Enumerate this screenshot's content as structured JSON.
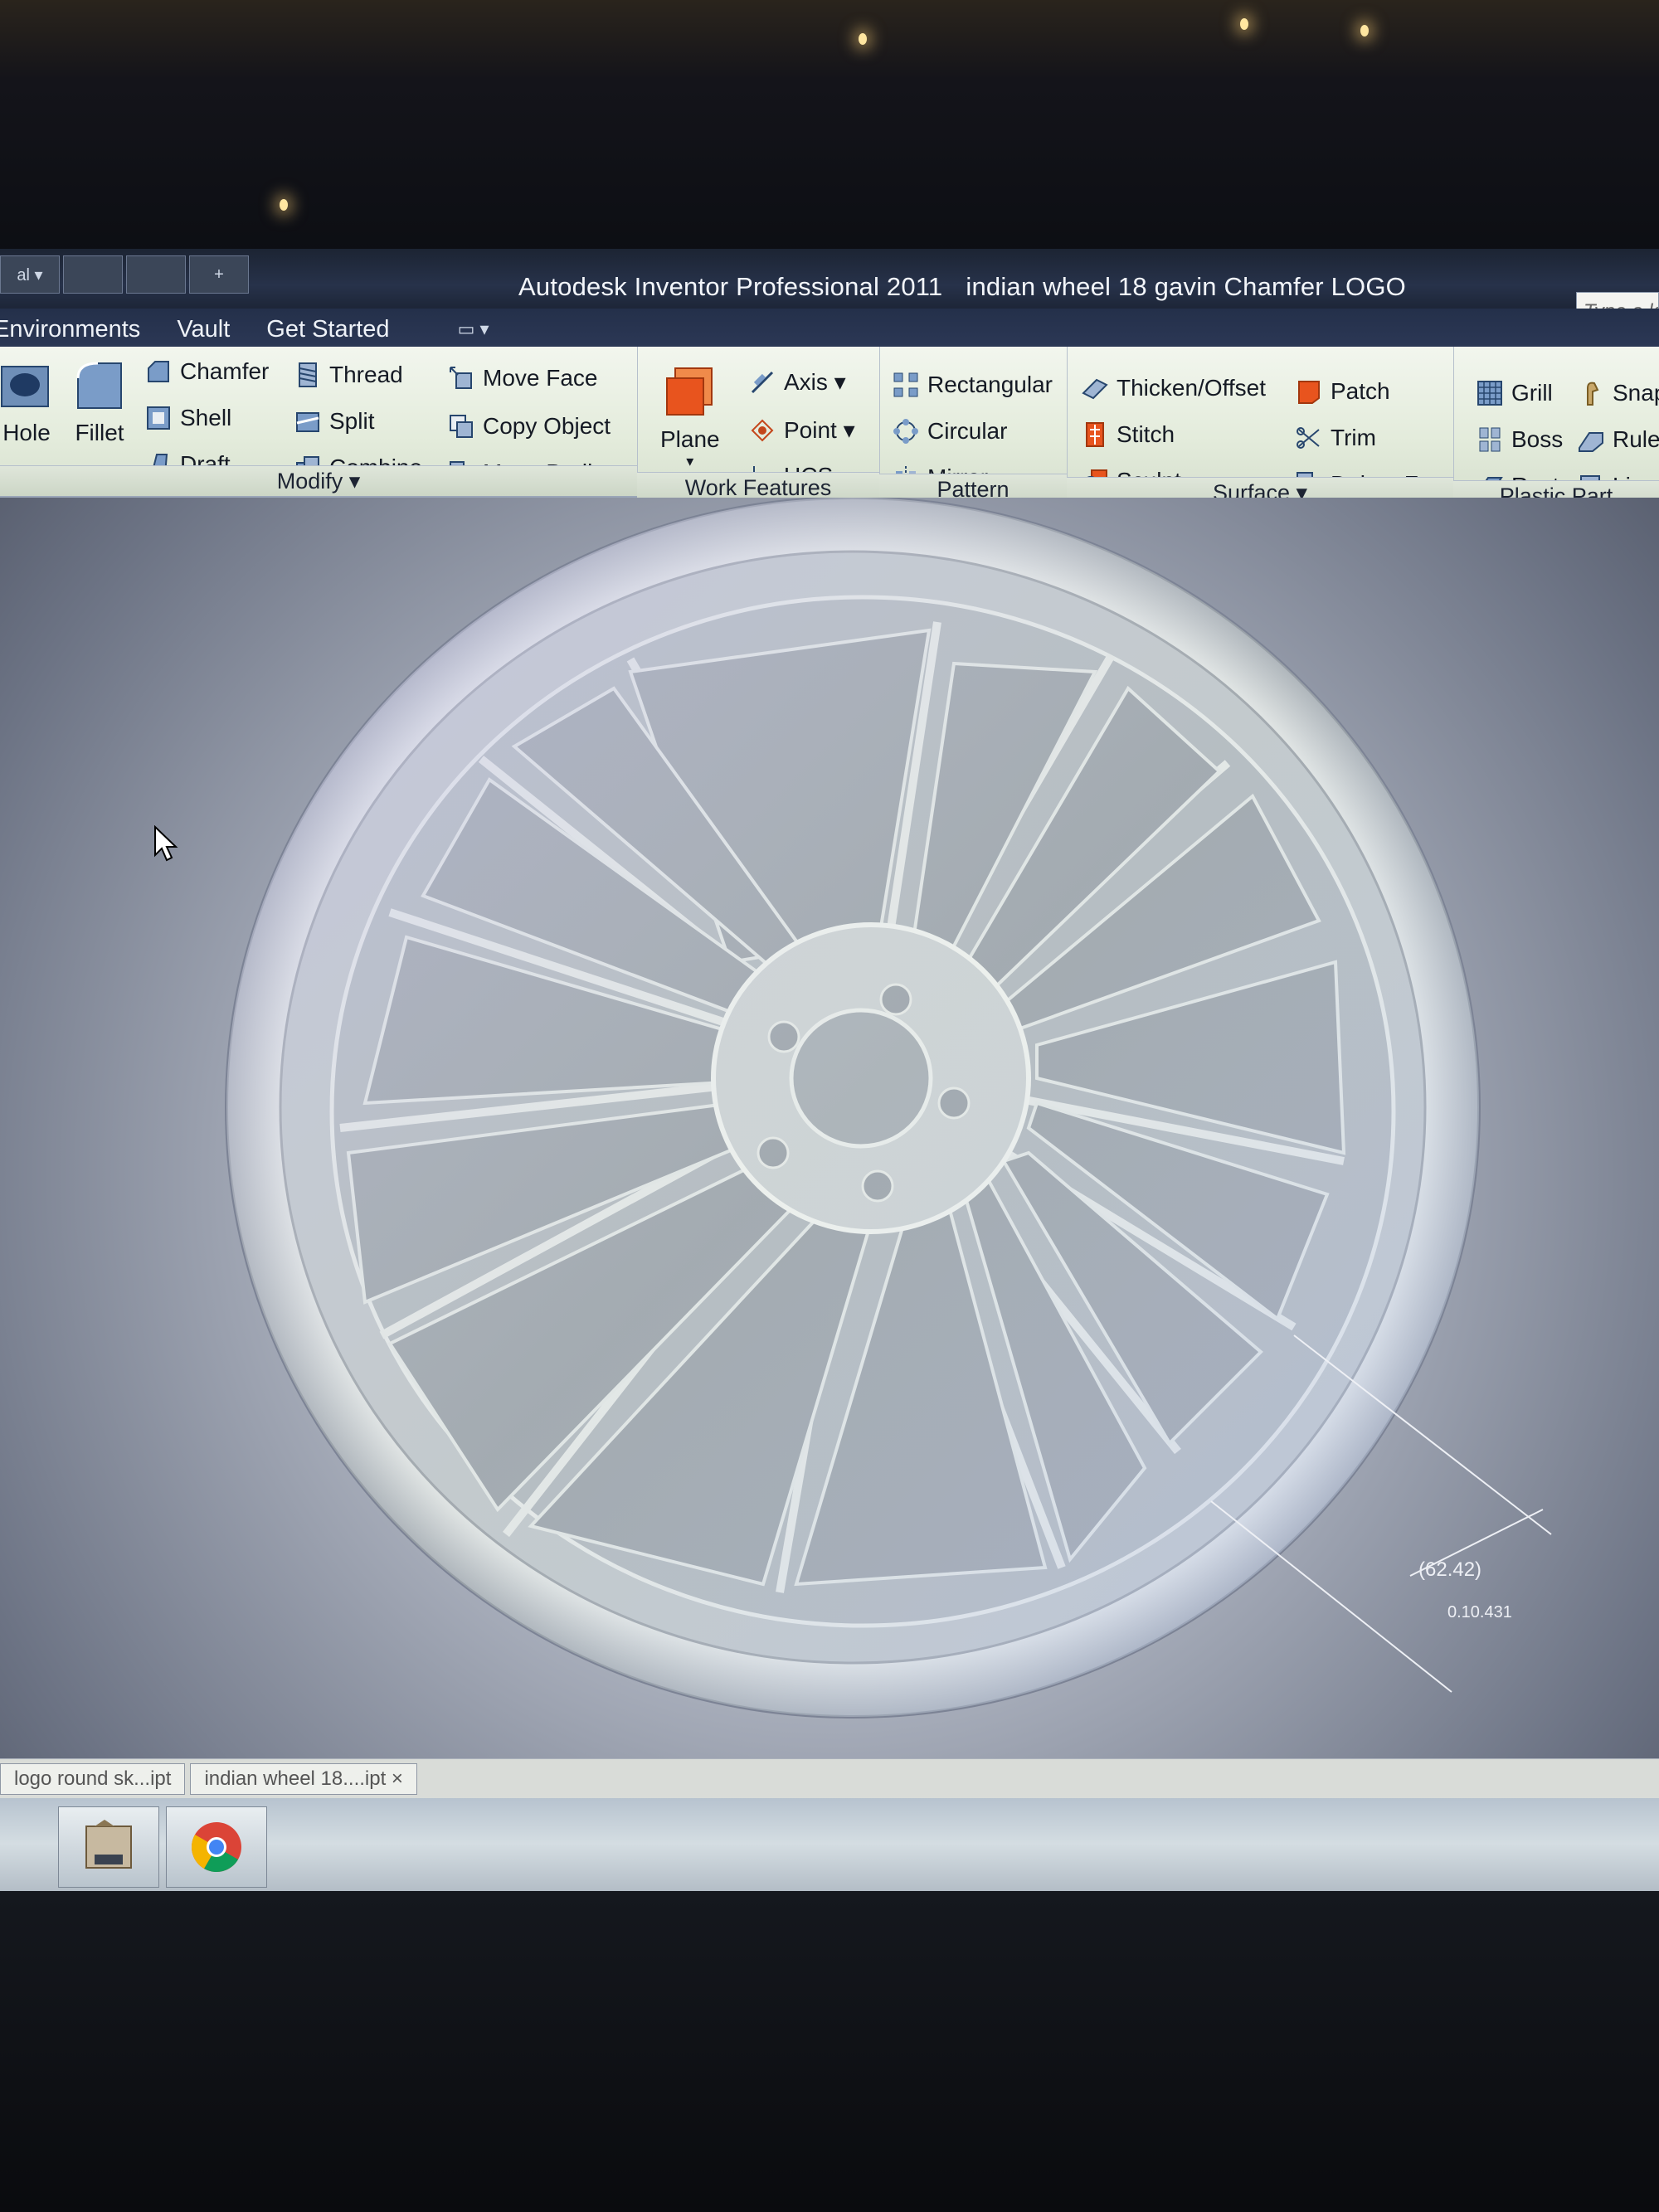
{
  "window": {
    "app_title": "Autodesk Inventor Professional 2011",
    "document_title": "indian wheel 18 gavin Chamfer LOGO",
    "help_search_placeholder": "Type a ke",
    "quick_access": [
      "al ▾",
      "",
      "",
      "+"
    ]
  },
  "tabs": [
    {
      "label": "Environments"
    },
    {
      "label": "Vault"
    },
    {
      "label": "Get Started"
    }
  ],
  "ribbon": {
    "modify": {
      "label": "Modify ▾",
      "hole": "Hole",
      "fillet": "Fillet",
      "chamfer": "Chamfer",
      "shell": "Shell",
      "draft": "Draft",
      "thread": "Thread",
      "split": "Split",
      "combine": "Combine",
      "move_face": "Move Face",
      "copy_object": "Copy Object",
      "move_bodies": "Move Bodies"
    },
    "work_features": {
      "label": "Work Features",
      "plane": "Plane",
      "axis": "Axis ▾",
      "point": "Point ▾",
      "ucs": "UCS"
    },
    "pattern": {
      "label": "Pattern",
      "rectangular": "Rectangular",
      "circular": "Circular",
      "mirror": "Mirror"
    },
    "surface": {
      "label": "Surface ▾",
      "thicken_offset": "Thicken/Offset",
      "stitch": "Stitch",
      "sculpt": "Sculpt",
      "patch": "Patch",
      "trim": "Trim",
      "delete_face": "Delete Face"
    },
    "plastic_part": {
      "label": "Plastic Part",
      "grill": "Grill",
      "boss": "Boss",
      "rest": "Rest",
      "snap": "Snap",
      "rule": "Rule",
      "lip": "Lip"
    }
  },
  "viewport": {
    "dimension_1": "(62.42)",
    "dimension_2": "0.10.431"
  },
  "document_tabs": [
    {
      "label": "logo round sk...ipt"
    },
    {
      "label": "indian wheel 18....ipt ×"
    }
  ],
  "taskbar": {
    "apps": [
      "inventor-pro",
      "chrome"
    ]
  },
  "colors": {
    "ribbon_bg": "#e4ecdc",
    "titlebar_bg": "#1c2433",
    "plane_icon": "#e8541e"
  }
}
